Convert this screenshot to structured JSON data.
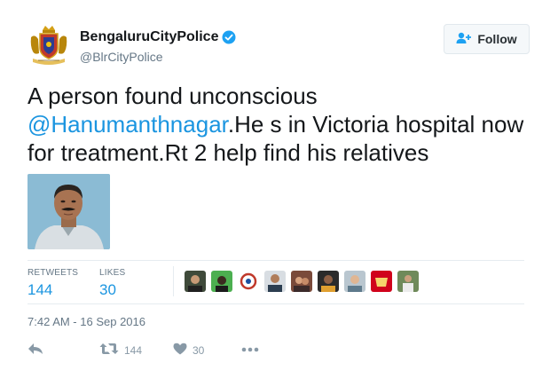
{
  "user": {
    "display_name": "BengaluruCityPolice",
    "handle": "@BlrCityPolice",
    "verified_icon": "verified-badge-icon",
    "avatar_icon": "police-emblem-icon"
  },
  "follow_button": {
    "label": "Follow",
    "icon": "add-user-icon"
  },
  "tweet": {
    "text_before": "A person found unconscious",
    "mention": "@Hanumanthnagar",
    "text_after": ".He s in Victoria hospital now for treatment.Rt 2 help find his relatives"
  },
  "stats": {
    "retweets_label": "RETWEETS",
    "retweets_value": "144",
    "likes_label": "LIKES",
    "likes_value": "30"
  },
  "timestamp": "7:42 AM - 16 Sep 2016",
  "actions": {
    "reply_icon": "reply-icon",
    "retweet_icon": "retweet-icon",
    "retweet_count": "144",
    "like_icon": "heart-icon",
    "like_count": "30",
    "more_icon": "more-icon"
  },
  "colors": {
    "link": "#1b95e0",
    "verified": "#1da1f2",
    "muted": "#657786"
  }
}
